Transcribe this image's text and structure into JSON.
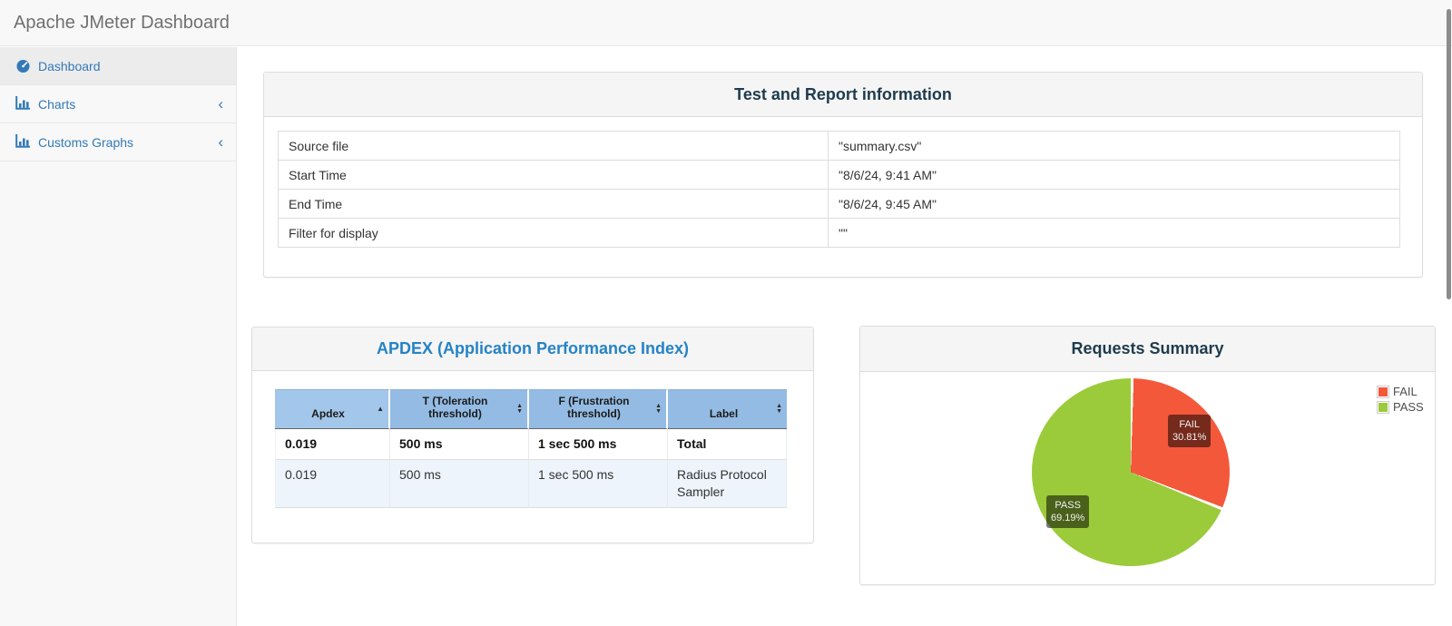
{
  "navbar": {
    "title": "Apache JMeter Dashboard"
  },
  "sidebar": {
    "chevron": "‹",
    "items": [
      {
        "label": "Dashboard",
        "icon": "tachometer-icon",
        "active": true
      },
      {
        "label": "Charts",
        "icon": "bar-chart-icon",
        "collapsed": true
      },
      {
        "label": "Customs Graphs",
        "icon": "bar-chart-icon",
        "collapsed": true
      }
    ]
  },
  "test_info": {
    "title": "Test and Report information",
    "rows": [
      {
        "label": "Source file",
        "value": "\"summary.csv\""
      },
      {
        "label": "Start Time",
        "value": "\"8/6/24, 9:41 AM\""
      },
      {
        "label": "End Time",
        "value": "\"8/6/24, 9:45 AM\""
      },
      {
        "label": "Filter for display",
        "value": "\"\""
      }
    ]
  },
  "apdex": {
    "title": "APDEX (Application Performance Index)",
    "headers": [
      {
        "label": "Apdex",
        "sort": "asc"
      },
      {
        "label": "T (Toleration threshold)",
        "sort": "both"
      },
      {
        "label": "F (Frustration threshold)",
        "sort": "both"
      },
      {
        "label": "Label",
        "sort": "both"
      }
    ],
    "rows": [
      {
        "cells": [
          "0.019",
          "500 ms",
          "1 sec 500 ms",
          "Total"
        ],
        "bold": true
      },
      {
        "cells": [
          "0.019",
          "500 ms",
          "1 sec 500 ms",
          "Radius Protocol Sampler"
        ],
        "bold": false
      }
    ]
  },
  "requests_summary": {
    "title": "Requests Summary",
    "chart_data": {
      "type": "pie",
      "start_angle_deg": 0,
      "legend_position": "top-right",
      "slices": [
        {
          "name": "FAIL",
          "value": 30.81,
          "percent_text": "30.81%",
          "color": "#f4583b"
        },
        {
          "name": "PASS",
          "value": 69.19,
          "percent_text": "69.19%",
          "color": "#9bcb3a"
        }
      ]
    }
  }
}
